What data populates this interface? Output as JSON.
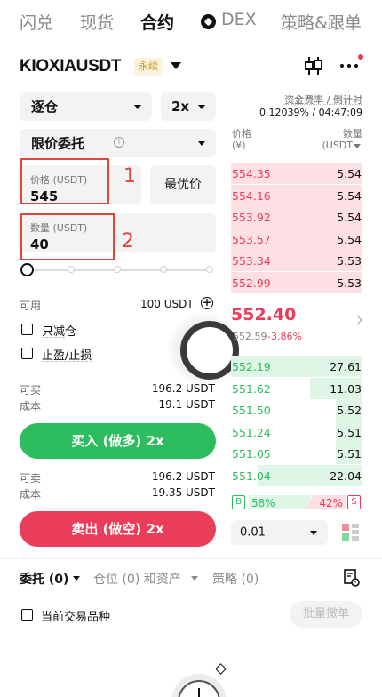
{
  "nav": {
    "tabs": [
      "闪兑",
      "现货",
      "合约",
      "DEX",
      "策略&跟单"
    ],
    "active": "合约"
  },
  "header": {
    "symbol": "KIOXIAUSDT",
    "badge": "永续"
  },
  "funding": {
    "label": "资金费率 / 倒计时",
    "value": "0.12039% / 04:47:09"
  },
  "form": {
    "margin_mode": "逐仓",
    "leverage": "2x",
    "order_type": "限价委托",
    "price_label": "价格 (USDT)",
    "price_value": "545",
    "best_price_label": "最优价",
    "qty_label": "数量 (USDT)",
    "qty_value": "40",
    "annotation_1": "1",
    "annotation_2": "2",
    "available_label": "可用",
    "available_value": "100 USDT",
    "reduce_only": "只减仓",
    "tp_sl": "止盈/止损",
    "can_buy_label": "可买",
    "can_buy_value": "196.2 USDT",
    "buy_cost_label": "成本",
    "buy_cost_value": "19.1 USDT",
    "buy_button": "买入 (做多) 2x",
    "can_sell_label": "可卖",
    "can_sell_value": "196.2 USDT",
    "sell_cost_label": "成本",
    "sell_cost_value": "19.35 USDT",
    "sell_button": "卖出 (做空) 2x"
  },
  "orderbook": {
    "price_header": "价格",
    "price_unit": "(¥)",
    "qty_header": "数量",
    "qty_unit": "(USDT",
    "asks": [
      {
        "price": "554.35",
        "qty": "5.54",
        "depth": 1.0
      },
      {
        "price": "554.16",
        "qty": "5.54",
        "depth": 1.0
      },
      {
        "price": "553.92",
        "qty": "5.54",
        "depth": 1.0
      },
      {
        "price": "553.57",
        "qty": "5.54",
        "depth": 1.0
      },
      {
        "price": "553.34",
        "qty": "5.53",
        "depth": 1.0
      },
      {
        "price": "552.99",
        "qty": "5.53",
        "depth": 1.0
      }
    ],
    "last_price": "552.40",
    "mark_price": "552.59",
    "change": "-3.86%",
    "bids": [
      {
        "price": "552.19",
        "qty": "27.61",
        "depth": 1.0
      },
      {
        "price": "551.62",
        "qty": "11.03",
        "depth": 0.4
      },
      {
        "price": "551.50",
        "qty": "5.52",
        "depth": 0.2
      },
      {
        "price": "551.24",
        "qty": "5.51",
        "depth": 0.2
      },
      {
        "price": "551.05",
        "qty": "5.51",
        "depth": 0.2
      },
      {
        "price": "551.04",
        "qty": "22.04",
        "depth": 0.8
      }
    ],
    "buy_ratio_tag": "B",
    "buy_ratio": "58%",
    "sell_ratio": "42%",
    "sell_ratio_tag": "S",
    "precision": "0.01"
  },
  "bottom": {
    "tab_orders": "委托 (0)",
    "tab_positions": "仓位 (0) 和资产",
    "tab_strategy": "策略 (0)",
    "current_symbol_only": "当前交易品种",
    "batch_cancel": "批量撤单"
  },
  "colors": {
    "buy": "#2dbd5e",
    "sell": "#ea3d5a",
    "annotation": "#e0463e",
    "badge": "#c9931b"
  }
}
